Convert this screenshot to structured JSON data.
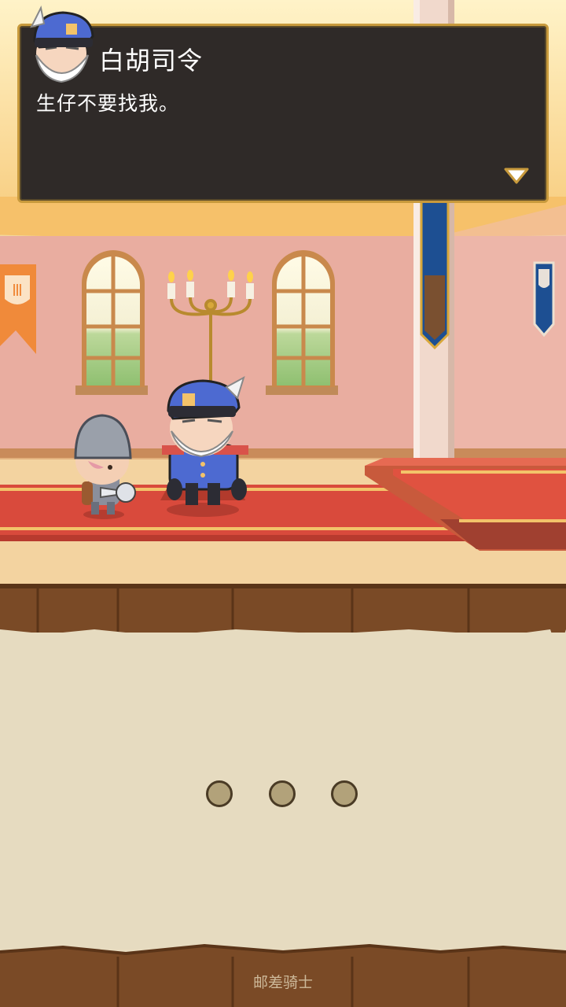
{
  "dialog": {
    "speaker": "白胡司令",
    "text": "生仔不要找我。"
  },
  "footer": {
    "label": "邮差骑士"
  },
  "loading_dots": 3,
  "colors": {
    "dialog_bg": "#2f2a28",
    "dialog_border": "#c89a3c",
    "carpet": "#d0483a",
    "wall": "#e8aca0",
    "panel": "#e6dbc0",
    "wood": "#7a4a26"
  },
  "icons": [
    "commander-portrait-icon",
    "continue-arrow-icon",
    "candelabra-icon",
    "banner-icon"
  ]
}
